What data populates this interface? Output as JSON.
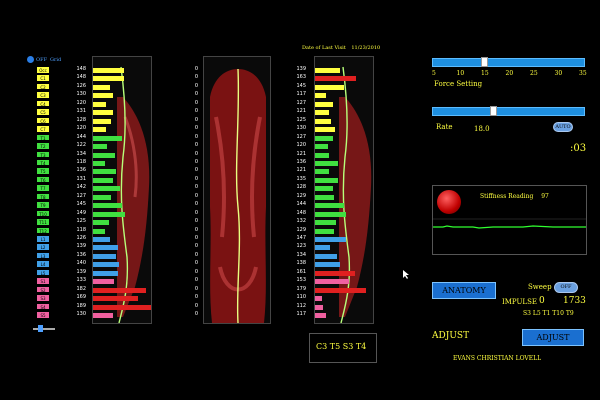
{
  "top": {
    "off_label": "OFF",
    "grid_label": "Grid",
    "visit_label": "Date of Last Visit",
    "visit_date": "11/23/2010"
  },
  "segments": [
    {
      "label": "Occ",
      "value": "148",
      "color": "#ffff40"
    },
    {
      "label": "C1",
      "value": "148",
      "color": "#ffff40"
    },
    {
      "label": "C2",
      "value": "126",
      "color": "#ffff40"
    },
    {
      "label": "C3",
      "value": "130",
      "color": "#ffff40"
    },
    {
      "label": "C4",
      "value": "120",
      "color": "#ffff40"
    },
    {
      "label": "C5",
      "value": "131",
      "color": "#ffff40"
    },
    {
      "label": "C6",
      "value": "128",
      "color": "#ffff40"
    },
    {
      "label": "C7",
      "value": "120",
      "color": "#ffff40"
    },
    {
      "label": "T1",
      "value": "144",
      "color": "#40e040"
    },
    {
      "label": "T2",
      "value": "122",
      "color": "#40e040"
    },
    {
      "label": "T3",
      "value": "134",
      "color": "#40e040"
    },
    {
      "label": "T4",
      "value": "118",
      "color": "#40e040"
    },
    {
      "label": "T5",
      "value": "136",
      "color": "#40e040"
    },
    {
      "label": "T6",
      "value": "131",
      "color": "#40e040"
    },
    {
      "label": "T7",
      "value": "142",
      "color": "#40e040"
    },
    {
      "label": "T8",
      "value": "127",
      "color": "#40e040"
    },
    {
      "label": "T9",
      "value": "145",
      "color": "#40e040"
    },
    {
      "label": "T10",
      "value": "149",
      "color": "#40e040"
    },
    {
      "label": "T11",
      "value": "125",
      "color": "#40e040"
    },
    {
      "label": "T12",
      "value": "118",
      "color": "#40e040"
    },
    {
      "label": "L1",
      "value": "126",
      "color": "#40a0e8"
    },
    {
      "label": "L2",
      "value": "139",
      "color": "#40a0e8"
    },
    {
      "label": "L3",
      "value": "136",
      "color": "#40a0e8"
    },
    {
      "label": "L4",
      "value": "140",
      "color": "#40a0e8"
    },
    {
      "label": "L5",
      "value": "139",
      "color": "#40a0e8"
    },
    {
      "label": "S1",
      "value": "133",
      "color": "#f060a0"
    },
    {
      "label": "S2",
      "value": "182",
      "color": "#f060a0"
    },
    {
      "label": "S3",
      "value": "169",
      "color": "#f060a0"
    },
    {
      "label": "S4",
      "value": "189",
      "color": "#f060a0"
    },
    {
      "label": "S5",
      "value": "130",
      "color": "#f060a0"
    }
  ],
  "middle_values": [
    "0",
    "0",
    "0",
    "0",
    "0",
    "0",
    "0",
    "0",
    "0",
    "0",
    "0",
    "0",
    "0",
    "0",
    "0",
    "0",
    "0",
    "0",
    "0",
    "0",
    "0",
    "0",
    "0",
    "0",
    "0",
    "0",
    "0",
    "0",
    "0",
    "0"
  ],
  "right_values": [
    "139",
    "163",
    "145",
    "117",
    "127",
    "121",
    "125",
    "130",
    "127",
    "120",
    "121",
    "136",
    "121",
    "135",
    "128",
    "129",
    "144",
    "148",
    "132",
    "129",
    "147",
    "123",
    "134",
    "138",
    "161",
    "153",
    "179",
    "110",
    "112",
    "117"
  ],
  "result_box": "C3 T5 S3 T4",
  "force": {
    "ticks": [
      "5",
      "10",
      "15",
      "20",
      "25",
      "30",
      "35"
    ],
    "label": "Force Setting",
    "value": 15
  },
  "rate": {
    "label": "Rate",
    "value": "18.0",
    "auto_label": "AUTO",
    "time": ":03"
  },
  "stiffness": {
    "label": "Stiffness Reading",
    "value": "97"
  },
  "controls": {
    "anatomy_label": "ANATOMY",
    "sweep_label": "Sweep",
    "sweep_toggle": "OFF",
    "impulse_label": "IMPULSE",
    "impulse_value": "0",
    "impulse_count": "1733",
    "impulse_segments": "S3 L5 T1 T10 T9",
    "adjust_title": "ADJUST",
    "adjust_button": "ADJUST",
    "patient_name": "EVANS CHRISTIAN LOVELL"
  }
}
